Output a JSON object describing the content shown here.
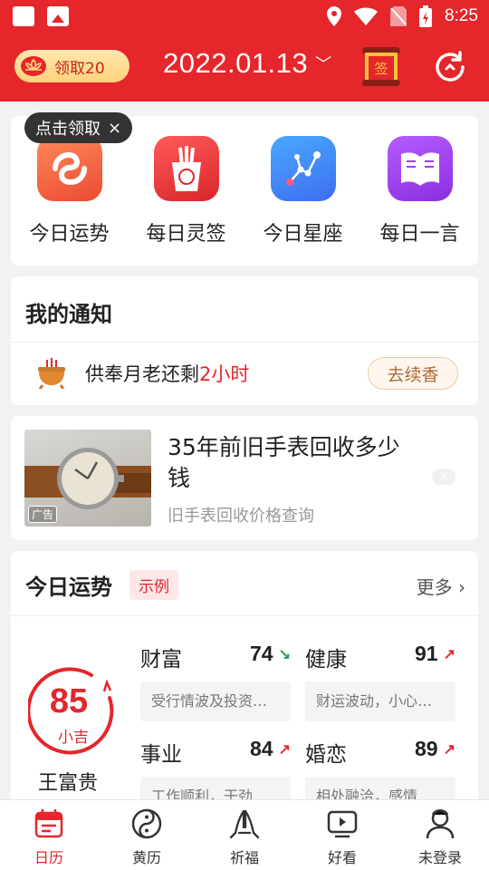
{
  "status": {
    "time": "8:25"
  },
  "header": {
    "reward_label": "领取20",
    "date": "2022.01.13",
    "qian_char": "签"
  },
  "tooltip": {
    "label": "点击领取",
    "close": "×"
  },
  "apps": [
    {
      "label": "今日运势",
      "color": "#f26a45"
    },
    {
      "label": "每日灵签",
      "color": "#e8393d"
    },
    {
      "label": "今日星座",
      "color": "#3c84ee"
    },
    {
      "label": "每日一言",
      "color": "#9b3fe6"
    }
  ],
  "notice": {
    "title": "我的通知",
    "text_before": "供奉月老还剩",
    "text_highlight": "2小时",
    "button": "去续香"
  },
  "ad": {
    "tag": "广告",
    "title": "35年前旧手表回收多少钱",
    "subtitle": "旧手表回收价格查询",
    "close": "×"
  },
  "fortune": {
    "title": "今日运势",
    "example_badge": "示例",
    "more": "更多",
    "score": "85",
    "level": "小吉",
    "name": "王富贵",
    "categories": [
      {
        "title": "财富",
        "value": "74",
        "trend": "down",
        "desc": "受行情波及投资不..."
      },
      {
        "title": "健康",
        "value": "91",
        "trend": "up",
        "desc": "财运波动，小心损..."
      },
      {
        "title": "事业",
        "value": "84",
        "trend": "up",
        "desc": "工作顺利，干劲十..."
      },
      {
        "title": "婚恋",
        "value": "89",
        "trend": "up",
        "desc": "相处融洽，感情升..."
      }
    ]
  },
  "nav": [
    {
      "label": "日历",
      "active": true
    },
    {
      "label": "黄历",
      "active": false
    },
    {
      "label": "祈福",
      "active": false
    },
    {
      "label": "好看",
      "active": false
    },
    {
      "label": "未登录",
      "active": false
    }
  ]
}
